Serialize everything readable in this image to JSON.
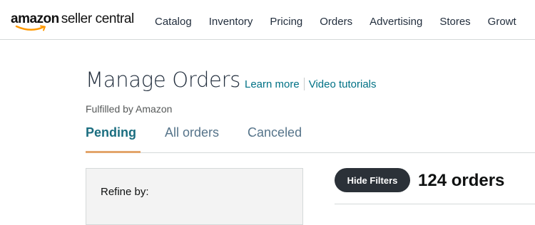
{
  "brand": {
    "name_bold": "amazon",
    "name_rest": "seller central"
  },
  "nav": {
    "items": [
      "Catalog",
      "Inventory",
      "Pricing",
      "Orders",
      "Advertising",
      "Stores",
      "Growt"
    ]
  },
  "header": {
    "title": "Manage Orders",
    "learn_more": "Learn more",
    "video_tutorials": "Video tutorials",
    "subtitle": "Fulfilled by Amazon"
  },
  "tabs": [
    {
      "label": "Pending",
      "active": true
    },
    {
      "label": "All orders",
      "active": false
    },
    {
      "label": "Canceled",
      "active": false
    }
  ],
  "refine": {
    "label": "Refine by:"
  },
  "results": {
    "hide_filters_label": "Hide Filters",
    "count_label": "124 orders"
  },
  "colors": {
    "link": "#007185",
    "active_tab": "#1b6e80",
    "tab_underline": "#e3a56b",
    "smile": "#ff9900"
  }
}
